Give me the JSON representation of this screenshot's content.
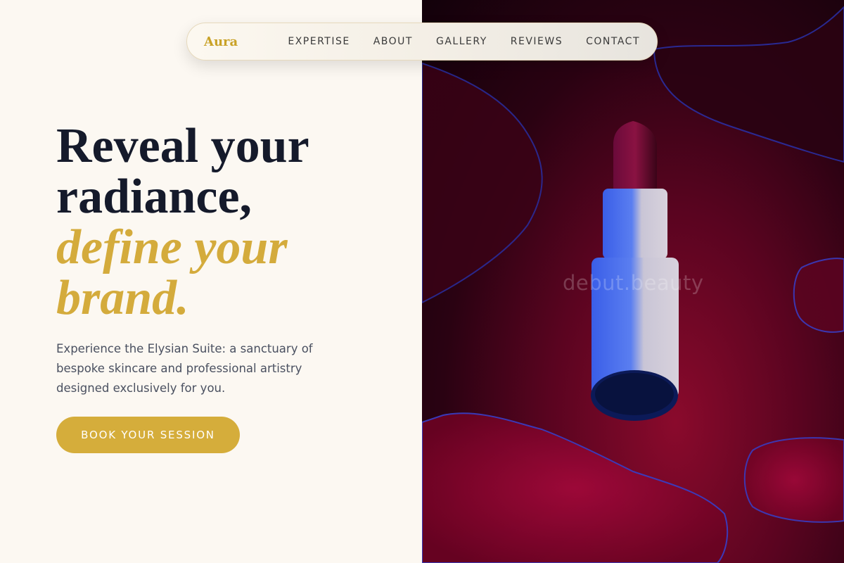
{
  "nav": {
    "logo": "Aura",
    "links": [
      "EXPERTISE",
      "ABOUT",
      "GALLERY",
      "REVIEWS",
      "CONTACT"
    ]
  },
  "hero": {
    "headline_line1": "Reveal your",
    "headline_line2": "radiance,",
    "headline_accent1": "define your",
    "headline_accent2": "brand.",
    "description": "Experience the Elysian Suite: a sanctuary of bespoke skincare and professional artistry designed exclusively for you.",
    "cta_label": "BOOK YOUR SESSION"
  },
  "image": {
    "watermark": "debut.beauty",
    "subject": "lipstick-image"
  },
  "colors": {
    "accent": "#d4ab3c",
    "background": "#fcf8f2",
    "heading": "#151a2b",
    "body_text": "#4a5060"
  }
}
